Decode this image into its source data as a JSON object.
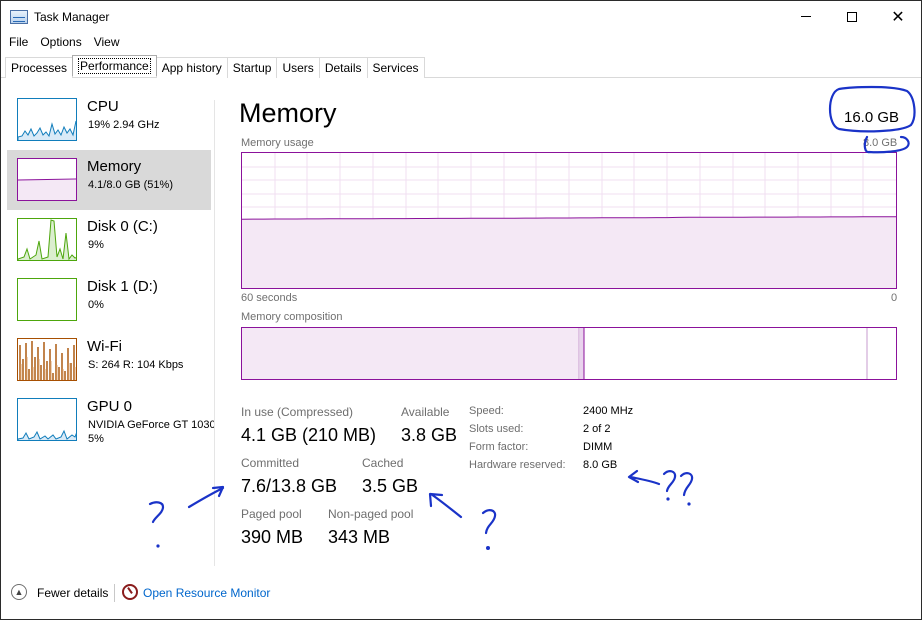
{
  "window": {
    "title": "Task Manager"
  },
  "menu": [
    "File",
    "Options",
    "View"
  ],
  "tabs": [
    "Processes",
    "Performance",
    "App history",
    "Startup",
    "Users",
    "Details",
    "Services"
  ],
  "sidebar": [
    {
      "name": "CPU",
      "sub": "19%  2.94 GHz",
      "color": "#117dbb"
    },
    {
      "name": "Memory",
      "sub": "4.1/8.0 GB (51%)",
      "color": "#8b129b"
    },
    {
      "name": "Disk 0 (C:)",
      "sub": "9%",
      "color": "#4da60c"
    },
    {
      "name": "Disk 1 (D:)",
      "sub": "0%",
      "color": "#4da60c"
    },
    {
      "name": "Wi-Fi",
      "sub_s_label": "S:",
      "sub_s": "264",
      "sub_r_label": "R:",
      "sub_r": "104 Kbps",
      "color": "#a74f01"
    },
    {
      "name": "GPU 0",
      "sub": "NVIDIA GeForce GT 1030",
      "sub2": "5%",
      "color": "#117dbb"
    }
  ],
  "main": {
    "title": "Memory",
    "total": "16.0 GB",
    "usage_label": "Memory usage",
    "usage_max": "8.0 GB",
    "time_left": "60 seconds",
    "time_right": "0",
    "composition_label": "Memory composition",
    "usage_level_fraction": 0.51
  },
  "stats": {
    "in_use_label": "In use (Compressed)",
    "in_use_value": "4.1 GB (210 MB)",
    "available_label": "Available",
    "available_value": "3.8 GB",
    "committed_label": "Committed",
    "committed_value": "7.6/13.8 GB",
    "cached_label": "Cached",
    "cached_value": "3.5 GB",
    "paged_label": "Paged pool",
    "paged_value": "390 MB",
    "nonpaged_label": "Non-paged pool",
    "nonpaged_value": "343 MB"
  },
  "details": {
    "speed_label": "Speed:",
    "speed_value": "2400 MHz",
    "slots_label": "Slots used:",
    "slots_value": "2 of 2",
    "form_label": "Form factor:",
    "form_value": "DIMM",
    "reserved_label": "Hardware reserved:",
    "reserved_value": "8.0 GB"
  },
  "footer": {
    "fewer_details": "Fewer details",
    "open_monitor": "Open Resource Monitor"
  },
  "colors": {
    "memory": "#8b129b",
    "annotation": "#1a33c8",
    "link": "#0066cc"
  },
  "icons": [
    "task-manager-icon",
    "minimize-icon",
    "maximize-icon",
    "close-icon",
    "chevron-up-icon",
    "resource-monitor-icon"
  ]
}
